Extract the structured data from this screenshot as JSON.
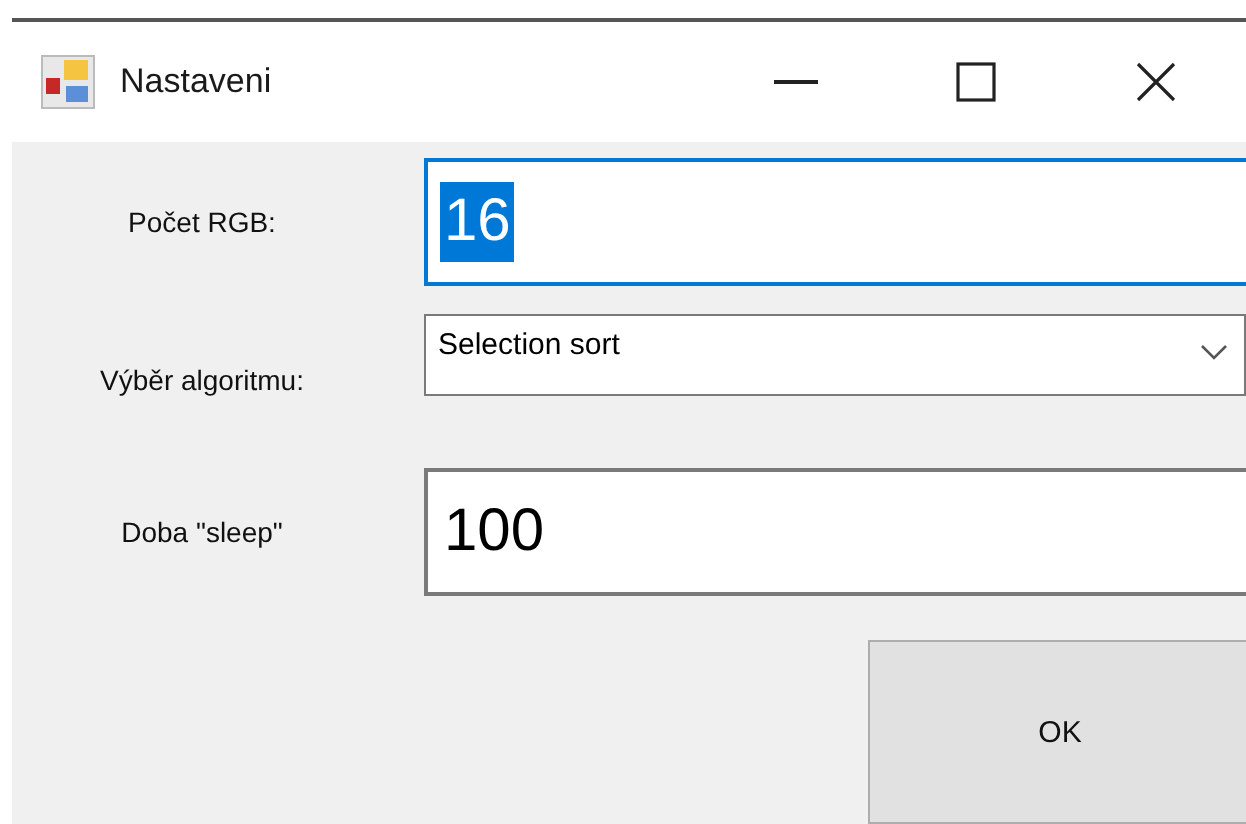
{
  "window": {
    "title": "Nastaveni"
  },
  "fields": [
    {
      "kind": "text",
      "label": "Počet RGB:",
      "value": "16",
      "focused": true,
      "text_selected": true
    },
    {
      "kind": "dropdown",
      "label": "Výběr algoritmu:",
      "value": "Selection sort",
      "focused": false,
      "text_selected": false
    },
    {
      "kind": "text",
      "label": "Doba \"sleep\"",
      "value": "100",
      "focused": false,
      "text_selected": false
    }
  ],
  "buttons": [
    {
      "label": "OK"
    }
  ]
}
